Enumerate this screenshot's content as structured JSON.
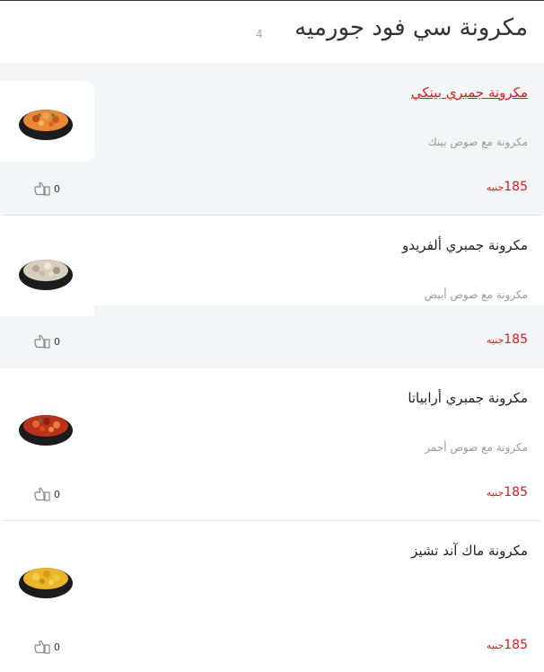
{
  "category": {
    "title": "مكرونة سي فود جورميه",
    "count": "4"
  },
  "colors": {
    "accent": "#d01e1e",
    "rowHighlight": "#f4f5f6"
  },
  "items": [
    {
      "name": "مكرونة جمبري بينكي",
      "description": "مكرونة مع صوص بينك",
      "price": "185",
      "currency": "جنيه",
      "likes": "0",
      "image_icon": "pink-sauce-shrimp-pasta-bowl"
    },
    {
      "name": "مكرونة جمبري ألفريدو",
      "description": "مكرونة مع صوص أبيض",
      "price": "185",
      "currency": "جنيه",
      "likes": "0",
      "image_icon": "alfredo-shrimp-pasta-bowl"
    },
    {
      "name": "مكرونة جمبري أرابياتا",
      "description": "مكرونة مع صوص أحمر",
      "price": "185",
      "currency": "جنيه",
      "likes": "0",
      "image_icon": "arrabbiata-shrimp-pasta-bowl"
    },
    {
      "name": "مكرونة ماك آند تشيز",
      "description": "",
      "price": "185",
      "currency": "جنيه",
      "likes": "0",
      "image_icon": "mac-and-cheese-bowl"
    }
  ]
}
